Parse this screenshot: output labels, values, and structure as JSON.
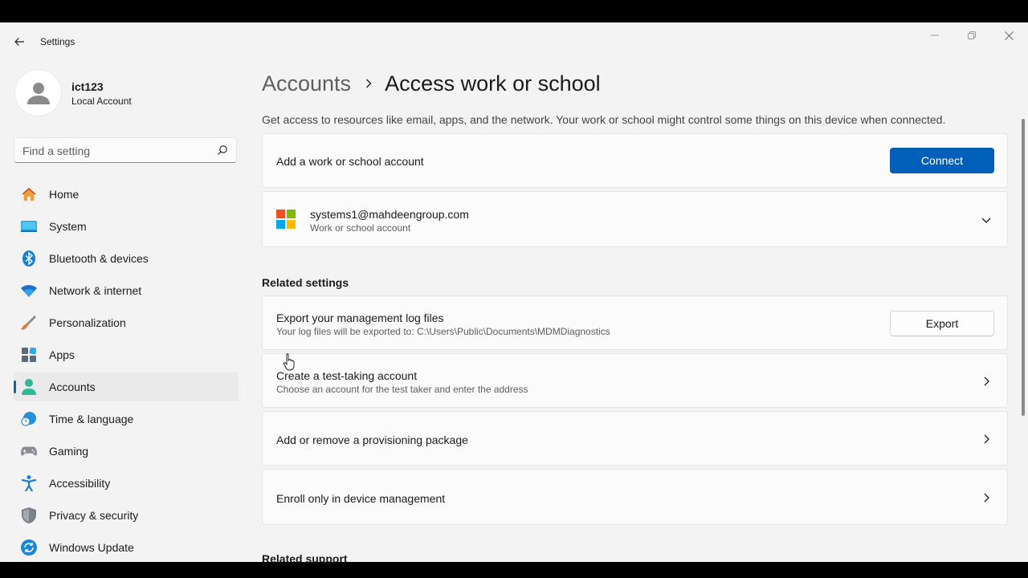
{
  "window": {
    "title": "Settings"
  },
  "user": {
    "name": "ict123",
    "account_type": "Local Account"
  },
  "search": {
    "placeholder": "Find a setting"
  },
  "nav": {
    "items": [
      {
        "label": "Home",
        "icon": "home-icon"
      },
      {
        "label": "System",
        "icon": "system-icon"
      },
      {
        "label": "Bluetooth & devices",
        "icon": "bluetooth-icon"
      },
      {
        "label": "Network & internet",
        "icon": "wifi-icon"
      },
      {
        "label": "Personalization",
        "icon": "brush-icon"
      },
      {
        "label": "Apps",
        "icon": "apps-icon"
      },
      {
        "label": "Accounts",
        "icon": "accounts-icon",
        "selected": true
      },
      {
        "label": "Time & language",
        "icon": "globe-clock-icon"
      },
      {
        "label": "Gaming",
        "icon": "gamepad-icon"
      },
      {
        "label": "Accessibility",
        "icon": "accessibility-icon"
      },
      {
        "label": "Privacy & security",
        "icon": "shield-icon"
      },
      {
        "label": "Windows Update",
        "icon": "update-icon"
      }
    ]
  },
  "main": {
    "breadcrumb_parent": "Accounts",
    "breadcrumb_current": "Access work or school",
    "description": "Get access to resources like email, apps, and the network. Your work or school might control some things on this device when connected.",
    "add_account": {
      "title": "Add a work or school account",
      "button": "Connect"
    },
    "connected_account": {
      "email": "systems1@mahdeengroup.com",
      "type": "Work or school account"
    },
    "related_settings_heading": "Related settings",
    "export_logs": {
      "title": "Export your management log files",
      "subtitle": "Your log files will be exported to: C:\\Users\\Public\\Documents\\MDMDiagnostics",
      "button": "Export"
    },
    "test_account": {
      "title": "Create a test-taking account",
      "subtitle": "Choose an account for the test taker and enter the address"
    },
    "provisioning": {
      "title": "Add or remove a provisioning package"
    },
    "enroll": {
      "title": "Enroll only in device management"
    },
    "related_support_heading": "Related support"
  },
  "colors": {
    "accent": "#005fb8",
    "window_bg": "#f3f3f3",
    "card_bg": "#fbfbfb"
  }
}
